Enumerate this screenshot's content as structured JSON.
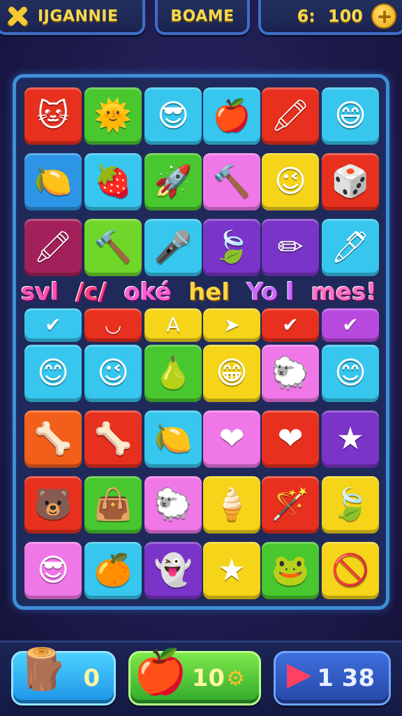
{
  "top_bar": {
    "left_label": "IJGANNIE",
    "mid_label": "BOAME",
    "score_label": "6:",
    "score_value": "100"
  },
  "board": {
    "banner_words": [
      "svl",
      "/c/",
      "oké",
      "hel",
      "Yo l",
      "mes!"
    ],
    "rows": [
      [
        {
          "color": "#e8301f",
          "icon": "cat-face-icon",
          "glyph": "🐱"
        },
        {
          "color": "#49c72e",
          "icon": "sun-face-icon",
          "glyph": "🌞"
        },
        {
          "color": "#36c6ee",
          "icon": "cool-sun-icon",
          "glyph": "😎"
        },
        {
          "color": "#36c6ee",
          "icon": "apple-icon",
          "glyph": "🍎"
        },
        {
          "color": "#e8301f",
          "icon": "crayon-icon",
          "glyph": "🖍"
        },
        {
          "color": "#36c6ee",
          "icon": "smiling-face-icon",
          "glyph": "😄"
        }
      ],
      [
        {
          "color": "#2d95e6",
          "icon": "fruit-icon",
          "glyph": "🍋"
        },
        {
          "color": "#36c6ee",
          "icon": "strawberry-icon",
          "glyph": "🍓"
        },
        {
          "color": "#49c72e",
          "icon": "rocket-icon",
          "glyph": "🚀"
        },
        {
          "color": "#f077e8",
          "icon": "brush-icon",
          "glyph": "🔨"
        },
        {
          "color": "#f5d419",
          "icon": "wink-face-icon",
          "glyph": "😉"
        },
        {
          "color": "#e8301f",
          "icon": "dice-icon",
          "glyph": "🎲"
        }
      ],
      [
        {
          "color": "#a4205a",
          "icon": "marker-icon",
          "glyph": "🖍"
        },
        {
          "color": "#6fd62a",
          "icon": "hammer-icon",
          "glyph": "🔨"
        },
        {
          "color": "#36c6ee",
          "icon": "microphone-icon",
          "glyph": "🎤"
        },
        {
          "color": "#7b34c8",
          "icon": "leaf-icon",
          "glyph": "🍃"
        },
        {
          "color": "#7b34c8",
          "icon": "pencil-icon",
          "glyph": "✏"
        },
        {
          "color": "#36c6ee",
          "icon": "pen-icon",
          "glyph": "🖊"
        }
      ],
      [
        {
          "color": "#36c6ee",
          "icon": "check-icon",
          "glyph": "✔"
        },
        {
          "color": "#e8301f",
          "icon": "smile-icon",
          "glyph": "◡"
        },
        {
          "color": "#f5d419",
          "icon": "letter-a-icon",
          "glyph": "A"
        },
        {
          "color": "#f5d419",
          "icon": "arrow-icon",
          "glyph": "➤"
        },
        {
          "color": "#e8301f",
          "icon": "checkmark-icon",
          "glyph": "✔"
        },
        {
          "color": "#b84ae0",
          "icon": "checkmark-green-icon",
          "glyph": "✔"
        }
      ],
      [
        {
          "color": "#36c6ee",
          "icon": "orange-face-icon",
          "glyph": "😊"
        },
        {
          "color": "#36c6ee",
          "icon": "wink-face-icon",
          "glyph": "😉"
        },
        {
          "color": "#49c72e",
          "icon": "pear-icon",
          "glyph": "🍐"
        },
        {
          "color": "#f5d419",
          "icon": "grin-face-icon",
          "glyph": "😁"
        },
        {
          "color": "#f077e8",
          "icon": "sheep-face-icon",
          "glyph": "🐑"
        },
        {
          "color": "#36c6ee",
          "icon": "happy-face-icon",
          "glyph": "😊"
        }
      ],
      [
        {
          "color": "#f25f1a",
          "icon": "bone-icon",
          "glyph": "🦴"
        },
        {
          "color": "#e8301f",
          "icon": "bone-icon",
          "glyph": "🦴"
        },
        {
          "color": "#36c6ee",
          "icon": "lemon-icon",
          "glyph": "🍋"
        },
        {
          "color": "#f077e8",
          "icon": "heart-icon",
          "glyph": "❤"
        },
        {
          "color": "#e8301f",
          "icon": "heart-icon",
          "glyph": "❤"
        },
        {
          "color": "#7b34c8",
          "icon": "star-icon",
          "glyph": "★"
        }
      ],
      [
        {
          "color": "#e8301f",
          "icon": "bear-face-icon",
          "glyph": "🐻"
        },
        {
          "color": "#49c72e",
          "icon": "bag-icon",
          "glyph": "👜"
        },
        {
          "color": "#f077e8",
          "icon": "sheep-face-icon",
          "glyph": "🐑"
        },
        {
          "color": "#f5d419",
          "icon": "popsicle-icon",
          "glyph": "🍦"
        },
        {
          "color": "#e8301f",
          "icon": "wand-icon",
          "glyph": "🪄"
        },
        {
          "color": "#f5d419",
          "icon": "leaf-icon",
          "glyph": "🍃"
        }
      ],
      [
        {
          "color": "#f077e8",
          "icon": "cat-sunglasses-icon",
          "glyph": "😎"
        },
        {
          "color": "#36c6ee",
          "icon": "orange-face-icon",
          "glyph": "🍊"
        },
        {
          "color": "#7b34c8",
          "icon": "ghost-face-icon",
          "glyph": "👻"
        },
        {
          "color": "#f5d419",
          "icon": "star-icon",
          "glyph": "★"
        },
        {
          "color": "#49c72e",
          "icon": "frog-icon",
          "glyph": "🐸"
        },
        {
          "color": "#f5d419",
          "icon": "no-sign-icon",
          "glyph": "🚫"
        }
      ]
    ]
  },
  "bottom_bar": {
    "left_value": "0",
    "mid_value": "10",
    "right_value": "1 38"
  }
}
